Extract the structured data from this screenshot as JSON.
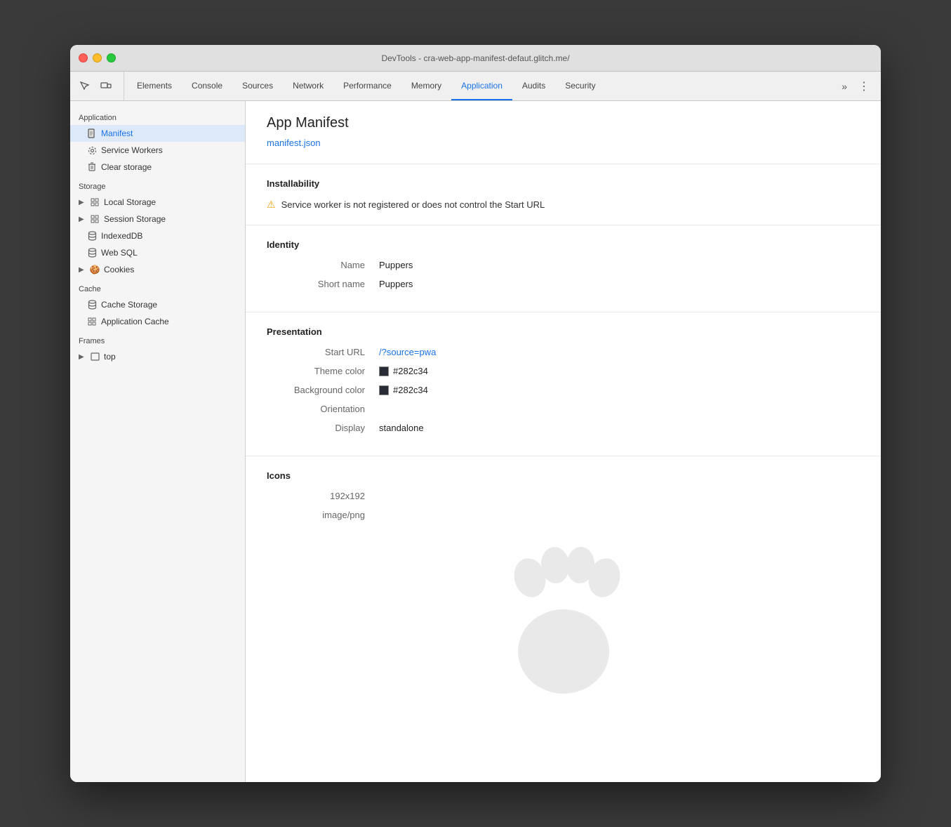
{
  "window": {
    "title": "DevTools - cra-web-app-manifest-defaut.glitch.me/"
  },
  "toolbar": {
    "icons": [
      {
        "name": "cursor-icon",
        "symbol": "⬡"
      },
      {
        "name": "device-icon",
        "symbol": "⬚"
      }
    ],
    "tabs": [
      {
        "id": "elements",
        "label": "Elements",
        "active": false
      },
      {
        "id": "console",
        "label": "Console",
        "active": false
      },
      {
        "id": "sources",
        "label": "Sources",
        "active": false
      },
      {
        "id": "network",
        "label": "Network",
        "active": false
      },
      {
        "id": "performance",
        "label": "Performance",
        "active": false
      },
      {
        "id": "memory",
        "label": "Memory",
        "active": false
      },
      {
        "id": "application",
        "label": "Application",
        "active": true
      },
      {
        "id": "audits",
        "label": "Audits",
        "active": false
      },
      {
        "id": "security",
        "label": "Security",
        "active": false
      }
    ],
    "more_label": "»",
    "menu_label": "⋮"
  },
  "sidebar": {
    "application_section": "Application",
    "items_application": [
      {
        "id": "manifest",
        "label": "Manifest",
        "icon": "file",
        "active": true,
        "indent": true
      },
      {
        "id": "service-workers",
        "label": "Service Workers",
        "icon": "gear",
        "active": false,
        "indent": true
      },
      {
        "id": "clear-storage",
        "label": "Clear storage",
        "icon": "trash",
        "active": false,
        "indent": true
      }
    ],
    "storage_section": "Storage",
    "items_storage": [
      {
        "id": "local-storage",
        "label": "Local Storage",
        "icon": "grid",
        "active": false,
        "arrow": true
      },
      {
        "id": "session-storage",
        "label": "Session Storage",
        "icon": "grid",
        "active": false,
        "arrow": true
      },
      {
        "id": "indexeddb",
        "label": "IndexedDB",
        "icon": "db",
        "active": false,
        "arrow": false,
        "indent": true
      },
      {
        "id": "websql",
        "label": "Web SQL",
        "icon": "db",
        "active": false,
        "arrow": false,
        "indent": true
      },
      {
        "id": "cookies",
        "label": "Cookies",
        "icon": "cookie",
        "active": false,
        "arrow": true
      }
    ],
    "cache_section": "Cache",
    "items_cache": [
      {
        "id": "cache-storage",
        "label": "Cache Storage",
        "icon": "db",
        "active": false,
        "indent": true
      },
      {
        "id": "application-cache",
        "label": "Application Cache",
        "icon": "grid",
        "active": false,
        "indent": true
      }
    ],
    "frames_section": "Frames",
    "items_frames": [
      {
        "id": "top",
        "label": "top",
        "icon": "frame",
        "active": false,
        "arrow": true
      }
    ]
  },
  "content": {
    "title": "App Manifest",
    "manifest_link": "manifest.json",
    "installability": {
      "heading": "Installability",
      "warning": "Service worker is not registered or does not control the Start URL"
    },
    "identity": {
      "heading": "Identity",
      "name_label": "Name",
      "name_value": "Puppers",
      "short_name_label": "Short name",
      "short_name_value": "Puppers"
    },
    "presentation": {
      "heading": "Presentation",
      "start_url_label": "Start URL",
      "start_url_value": "/?source=pwa",
      "theme_color_label": "Theme color",
      "theme_color_value": "#282c34",
      "background_color_label": "Background color",
      "background_color_value": "#282c34",
      "orientation_label": "Orientation",
      "orientation_value": "",
      "display_label": "Display",
      "display_value": "standalone"
    },
    "icons": {
      "heading": "Icons",
      "size": "192x192",
      "type": "image/png"
    }
  }
}
